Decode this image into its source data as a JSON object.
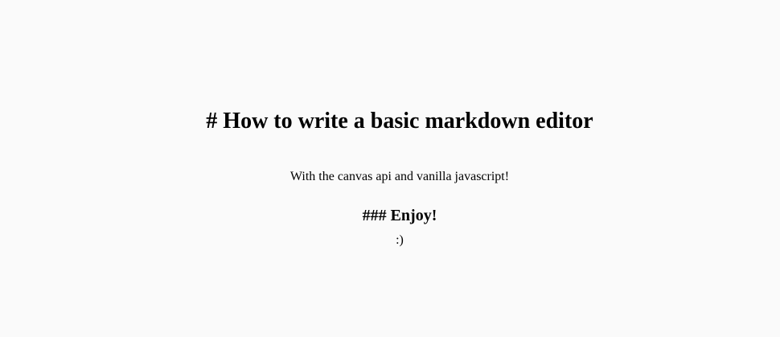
{
  "document": {
    "heading1": "# How to write a basic markdown editor",
    "paragraph": "With the canvas api and vanilla javascript!",
    "heading3": "### Enjoy!",
    "closing": ":)"
  }
}
